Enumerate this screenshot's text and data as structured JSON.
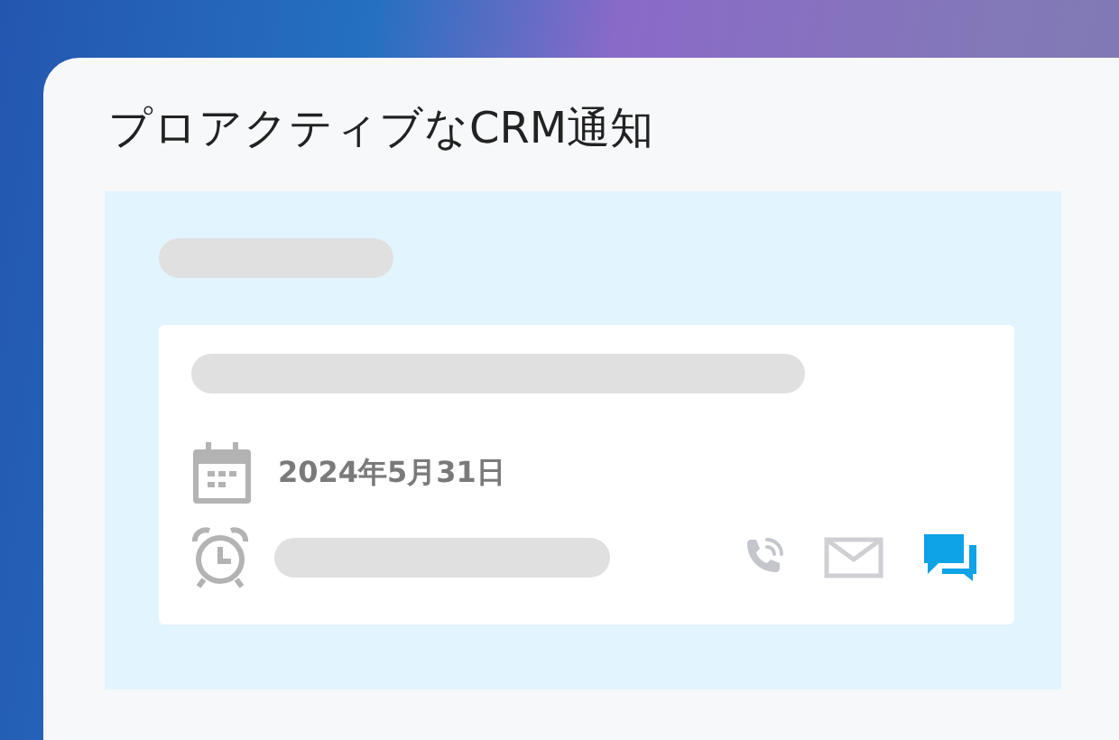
{
  "title": "プロアクティブなCRM通知",
  "notification": {
    "date": "2024年5月31日",
    "channels": [
      {
        "kind": "phone",
        "selected": false
      },
      {
        "kind": "mail",
        "selected": false
      },
      {
        "kind": "chat",
        "selected": true
      }
    ]
  }
}
